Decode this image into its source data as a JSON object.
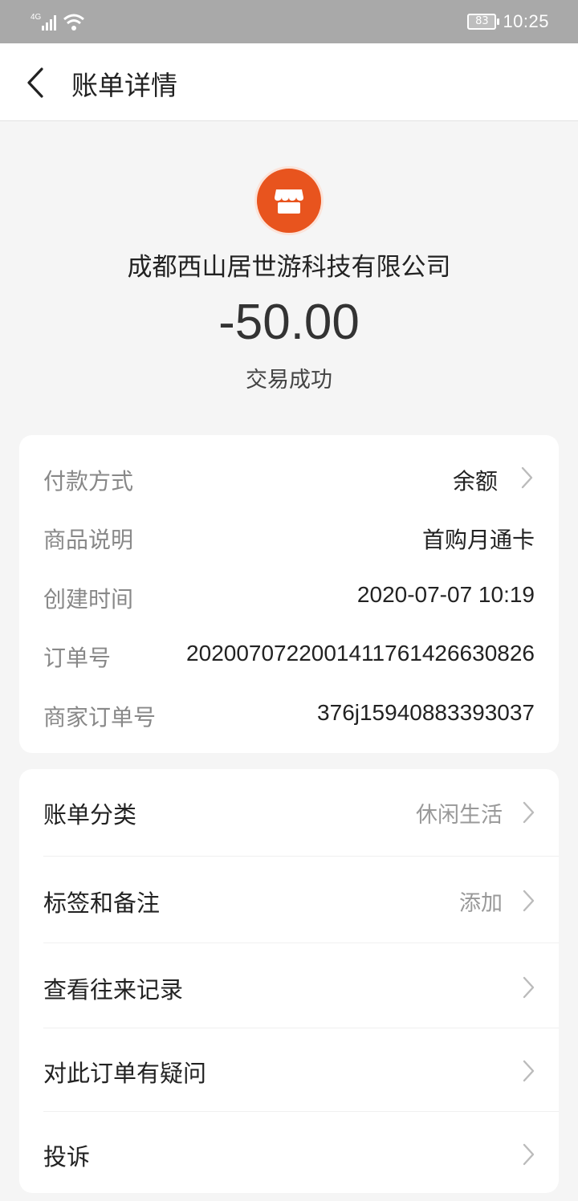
{
  "status_bar": {
    "network": "4G",
    "battery": "83",
    "time": "10:25"
  },
  "header": {
    "title": "账单详情"
  },
  "merchant": {
    "name": "成都西山居世游科技有限公司",
    "amount": "-50.00",
    "status": "交易成功",
    "logo_color": "#e8541e"
  },
  "details": [
    {
      "label": "付款方式",
      "value": "余额",
      "has_arrow": true
    },
    {
      "label": "商品说明",
      "value": "首购月通卡",
      "has_arrow": false
    },
    {
      "label": "创建时间",
      "value": "2020-07-07 10:19",
      "has_arrow": false
    },
    {
      "label": "订单号",
      "value": "2020070722001411761426630826",
      "has_arrow": false
    },
    {
      "label": "商家订单号",
      "value": "376j15940883393037",
      "has_arrow": false
    }
  ],
  "menu": [
    {
      "label": "账单分类",
      "value": "休闲生活"
    },
    {
      "label": "标签和备注",
      "value": "添加"
    },
    {
      "label": "查看往来记录",
      "value": ""
    },
    {
      "label": "对此订单有疑问",
      "value": ""
    },
    {
      "label": "投诉",
      "value": ""
    }
  ]
}
